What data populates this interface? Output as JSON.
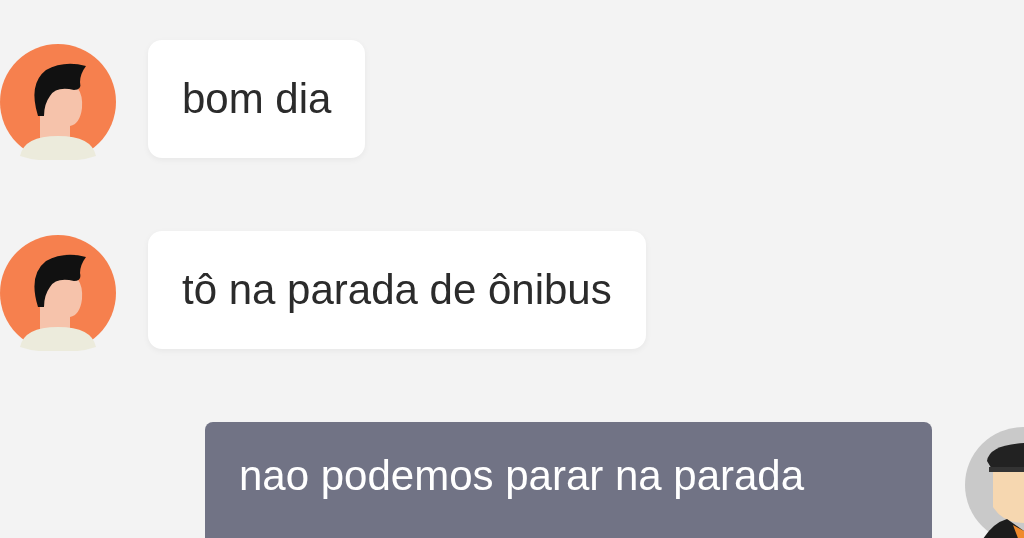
{
  "messages": [
    {
      "kind": "incoming",
      "text": "bom dia"
    },
    {
      "kind": "incoming",
      "text": "tô na parada de ônibus"
    },
    {
      "kind": "outgoing",
      "text": "nao podemos parar na parada"
    }
  ]
}
